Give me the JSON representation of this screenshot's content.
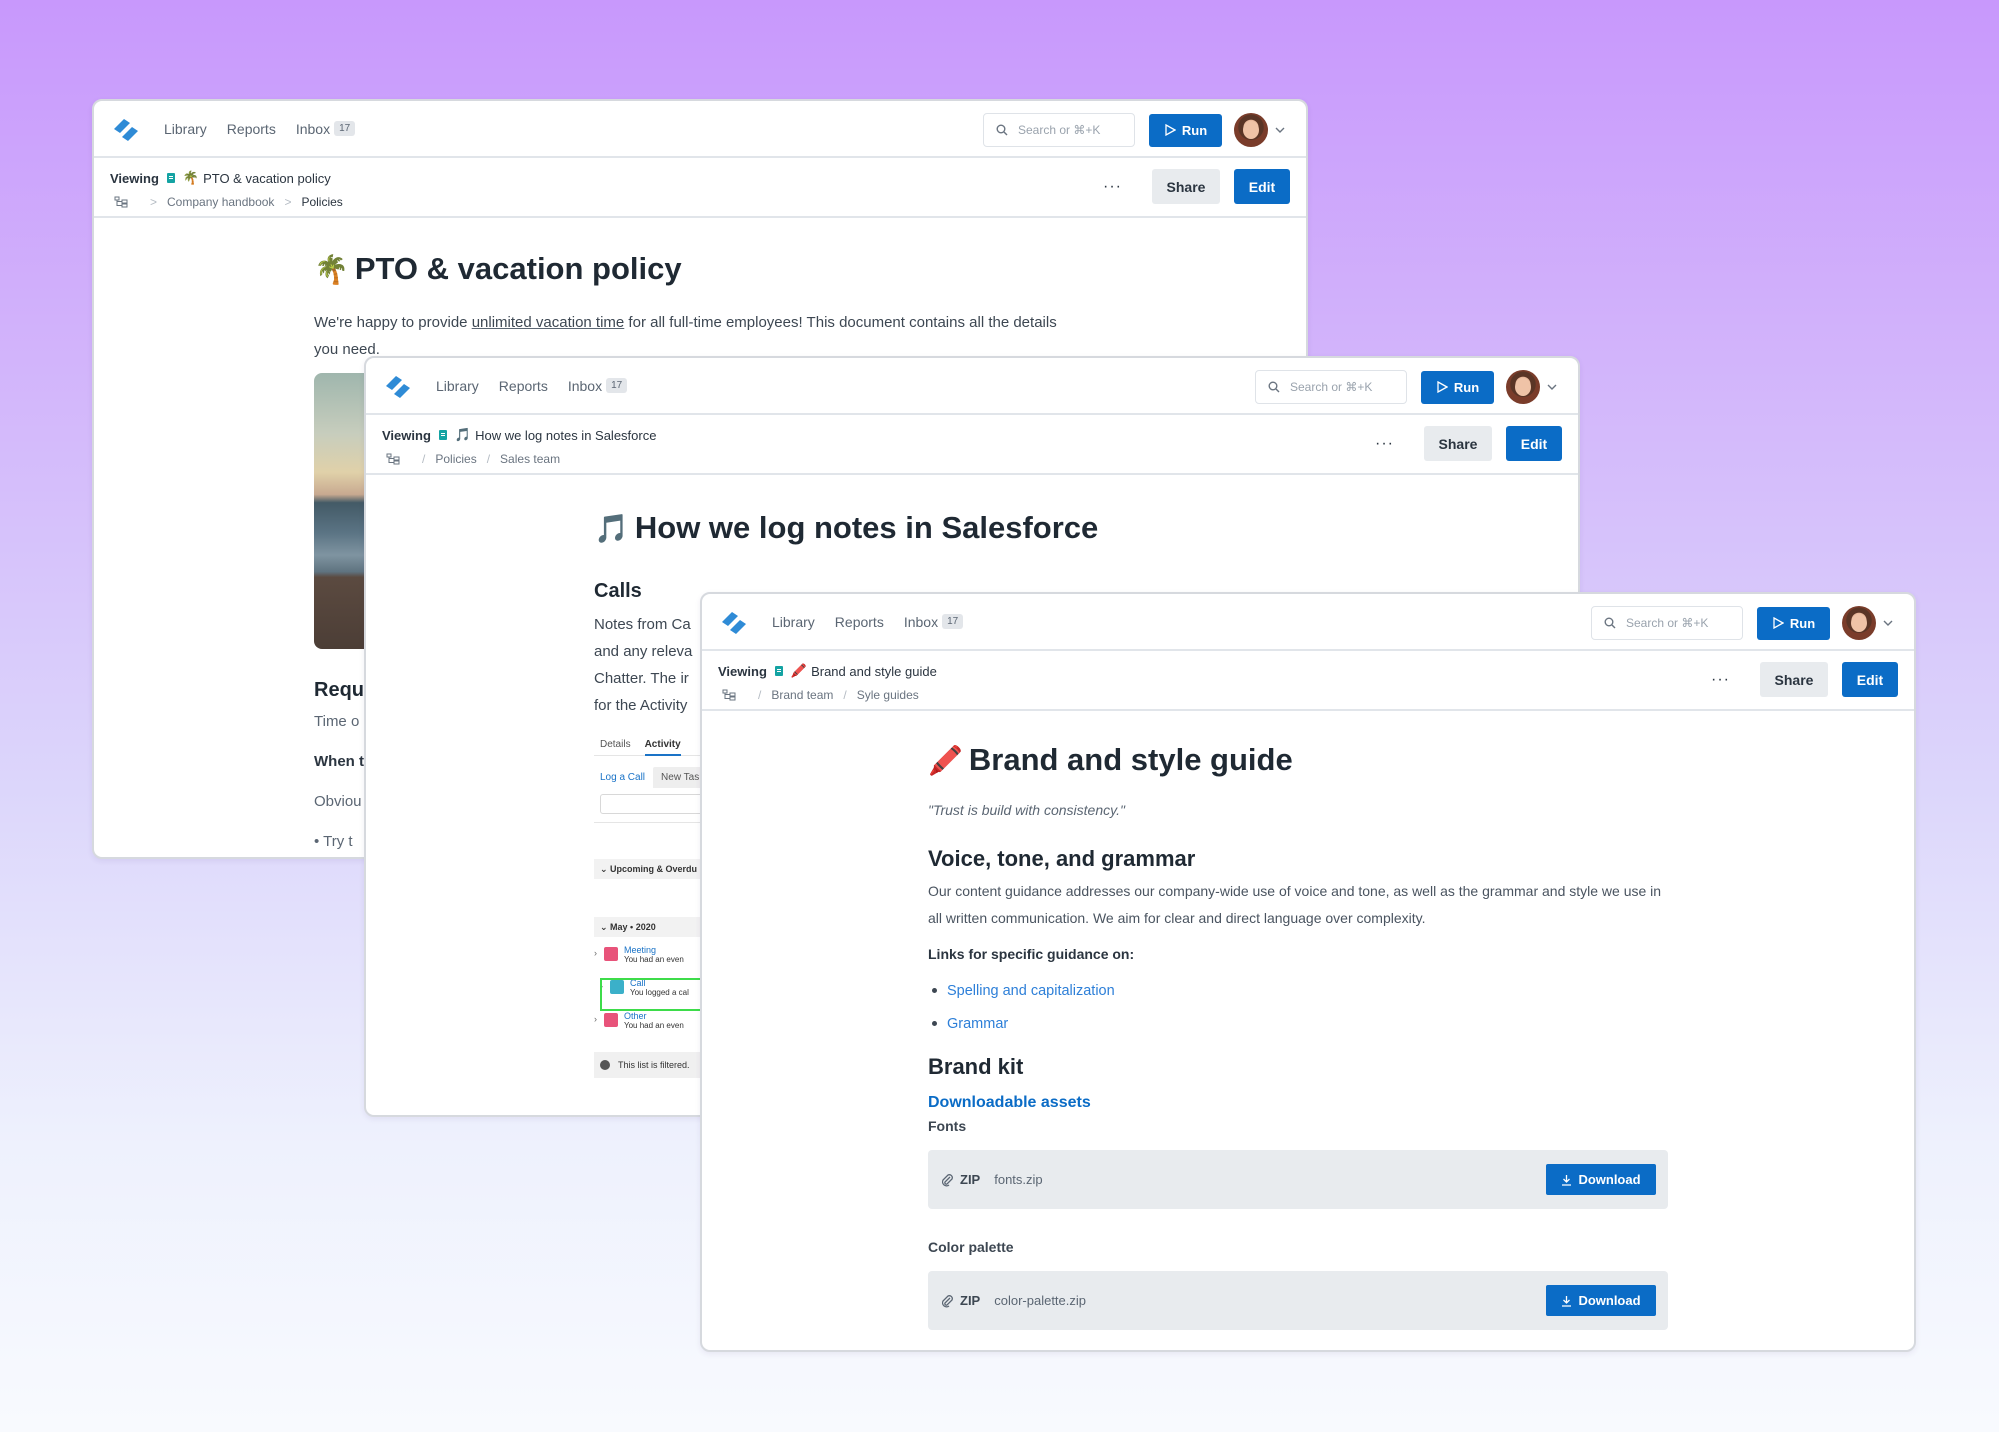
{
  "shared": {
    "nav": [
      "Library",
      "Reports",
      "Inbox"
    ],
    "inbox_count": "17",
    "search_placeholder": "Search or ⌘+K",
    "run_label": "Run",
    "viewing_label": "Viewing",
    "more_label": "···",
    "share_label": "Share",
    "edit_label": "Edit",
    "accent_color": "#0b6cc6"
  },
  "window1": {
    "doc_emoji": "🌴",
    "doc_title": "PTO & vacation policy",
    "breadcrumb_sep": ">",
    "breadcrumbs": [
      "Company handbook",
      "Policies"
    ],
    "heading": "PTO & vacation policy",
    "intro_before": "We're happy to provide ",
    "intro_link": "unlimited vacation time",
    "intro_after": " for all full-time employees! This document contains all the details you need.",
    "section_heading_partial": "Requ",
    "line1_partial": "Time o",
    "line2_partial": "When t",
    "line3_partial": "Obviou",
    "bullet_partial": "Try t"
  },
  "window2": {
    "doc_emoji": "🎵",
    "doc_title": "How we log notes in Salesforce",
    "breadcrumb_sep": "/",
    "breadcrumbs": [
      "Policies",
      "Sales team"
    ],
    "heading": "How we log notes in Salesforce",
    "section_heading": "Calls",
    "para_lines_partial": [
      "Notes from Ca",
      "and any releva",
      "Chatter. The ir",
      "for the Activity"
    ],
    "salesforce": {
      "tabs": [
        "Details",
        "Activity"
      ],
      "actions": [
        "Log a Call",
        "New Tas"
      ],
      "upcoming_label": "Upcoming & Overdu",
      "month_label": "May • 2020",
      "items": [
        {
          "title": "Meeting",
          "sub": "You had an even",
          "color": "#e8537a"
        },
        {
          "title": "Call",
          "sub": "You logged a cal",
          "color": "#3bb0c9"
        },
        {
          "title": "Other",
          "sub": "You had an even",
          "color": "#e8537a"
        }
      ],
      "filter_note": "This list is filtered."
    }
  },
  "window3": {
    "doc_emoji": "🖍️",
    "doc_title": "Brand and style guide",
    "breadcrumb_sep": "/",
    "breadcrumbs": [
      "Brand team",
      "Syle guides"
    ],
    "heading": "Brand and style guide",
    "quote": "\"Trust is build with consistency.\"",
    "voice_heading": "Voice, tone, and grammar",
    "voice_para": "Our content guidance addresses our company-wide use of voice and tone, as well as the grammar and style we use in all written communication. We aim for clear and direct language over complexity.",
    "links_label": "Links for specific guidance on:",
    "links": [
      "Spelling and capitalization",
      "Grammar"
    ],
    "brand_kit_heading": "Brand kit",
    "downloadable_assets": "Downloadable assets",
    "files": [
      {
        "section": "Fonts",
        "type": "ZIP",
        "name": "fonts.zip",
        "button": "Download"
      },
      {
        "section": "Color palette",
        "type": "ZIP",
        "name": "color-palette.zip",
        "button": "Download"
      }
    ]
  }
}
